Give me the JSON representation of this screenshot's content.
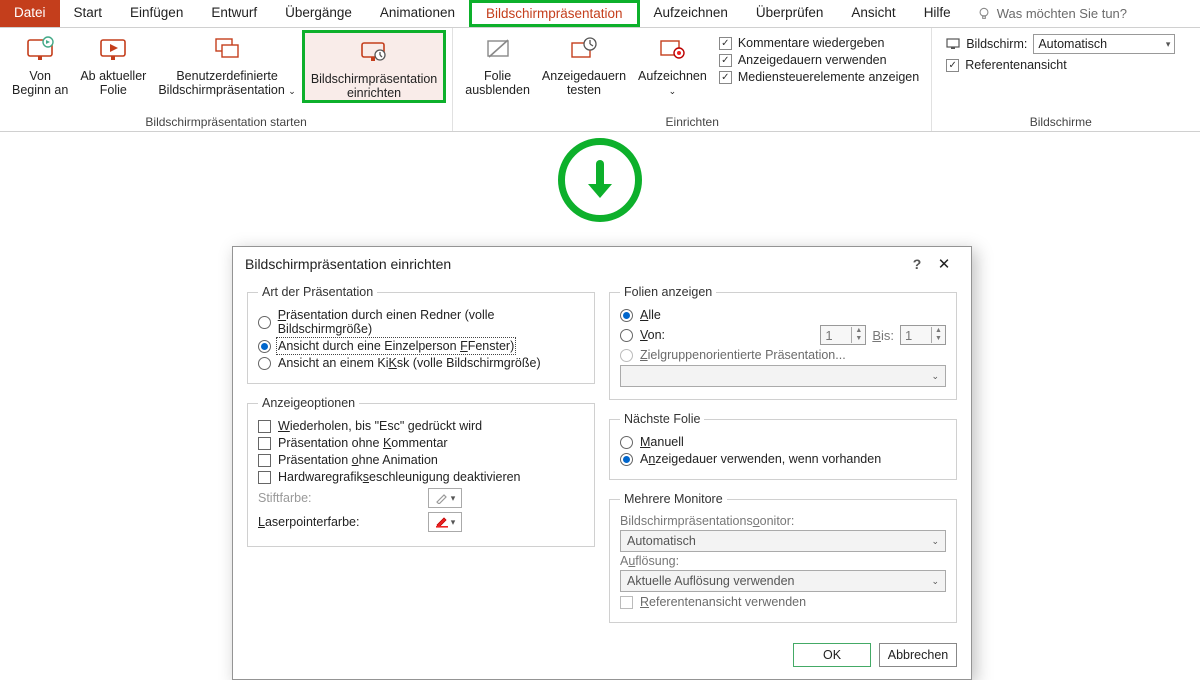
{
  "tabs": {
    "file": "Datei",
    "start": "Start",
    "einfuegen": "Einfügen",
    "entwurf": "Entwurf",
    "uebergaenge": "Übergänge",
    "animationen": "Animationen",
    "bildschirm": "Bildschirmpräsentation",
    "aufzeichnen": "Aufzeichnen",
    "ueberpruefen": "Überprüfen",
    "ansicht": "Ansicht",
    "hilfe": "Hilfe",
    "tellme": "Was möchten Sie tun?"
  },
  "ribbon": {
    "group1": {
      "label": "Bildschirmpräsentation starten",
      "from_start": "Von\nBeginn an",
      "from_current": "Ab aktueller\nFolie",
      "custom": "Benutzerdefinierte\nBildschirmpräsentation",
      "setup": "Bildschirmpräsentation\neinrichten"
    },
    "group2": {
      "label": "Einrichten",
      "hide": "Folie\nausblenden",
      "rehearse": "Anzeigedauern\ntesten",
      "record": "Aufzeichnen",
      "chk1": "Kommentare wiedergeben",
      "chk2": "Anzeigedauern verwenden",
      "chk3": "Mediensteuerelemente anzeigen"
    },
    "group3": {
      "label": "Bildschirme",
      "monitor_label": "Bildschirm:",
      "monitor_value": "Automatisch",
      "presenter": "Referentenansicht"
    }
  },
  "dialog": {
    "title": "Bildschirmpräsentation einrichten",
    "show_type": {
      "legend": "Art der Präsentation",
      "opt1": "Präsentation durch einen Redner (volle Bildschirmgröße)",
      "opt2": "Ansicht durch eine Einzelperson (Fenster)",
      "opt3": "Ansicht an einem Kiosk (volle Bildschirmgröße)"
    },
    "options": {
      "legend": "Anzeigeoptionen",
      "chk1": "Wiederholen, bis \"Esc\" gedrückt wird",
      "chk2": "Präsentation ohne Kommentar",
      "chk3": "Präsentation ohne Animation",
      "chk4": "Hardwaregrafikbeschleunigung deaktivieren",
      "pen_label": "Stiftfarbe:",
      "laser_label": "Laserpointerfarbe:"
    },
    "slides": {
      "legend": "Folien anzeigen",
      "all": "Alle",
      "from": "Von:",
      "to": "Bis:",
      "from_v": "1",
      "to_v": "1",
      "custom": "Zielgruppenorientierte Präsentation..."
    },
    "advance": {
      "legend": "Nächste Folie",
      "manual": "Manuell",
      "timings": "Anzeigedauer verwenden, wenn vorhanden"
    },
    "monitors": {
      "legend": "Mehrere Monitore",
      "mon_label": "Bildschirmpräsentationsmonitor:",
      "mon_value": "Automatisch",
      "res_label": "Auflösung:",
      "res_value": "Aktuelle Auflösung verwenden",
      "presenter": "Referentenansicht verwenden"
    },
    "ok": "OK",
    "cancel": "Abbrechen"
  }
}
